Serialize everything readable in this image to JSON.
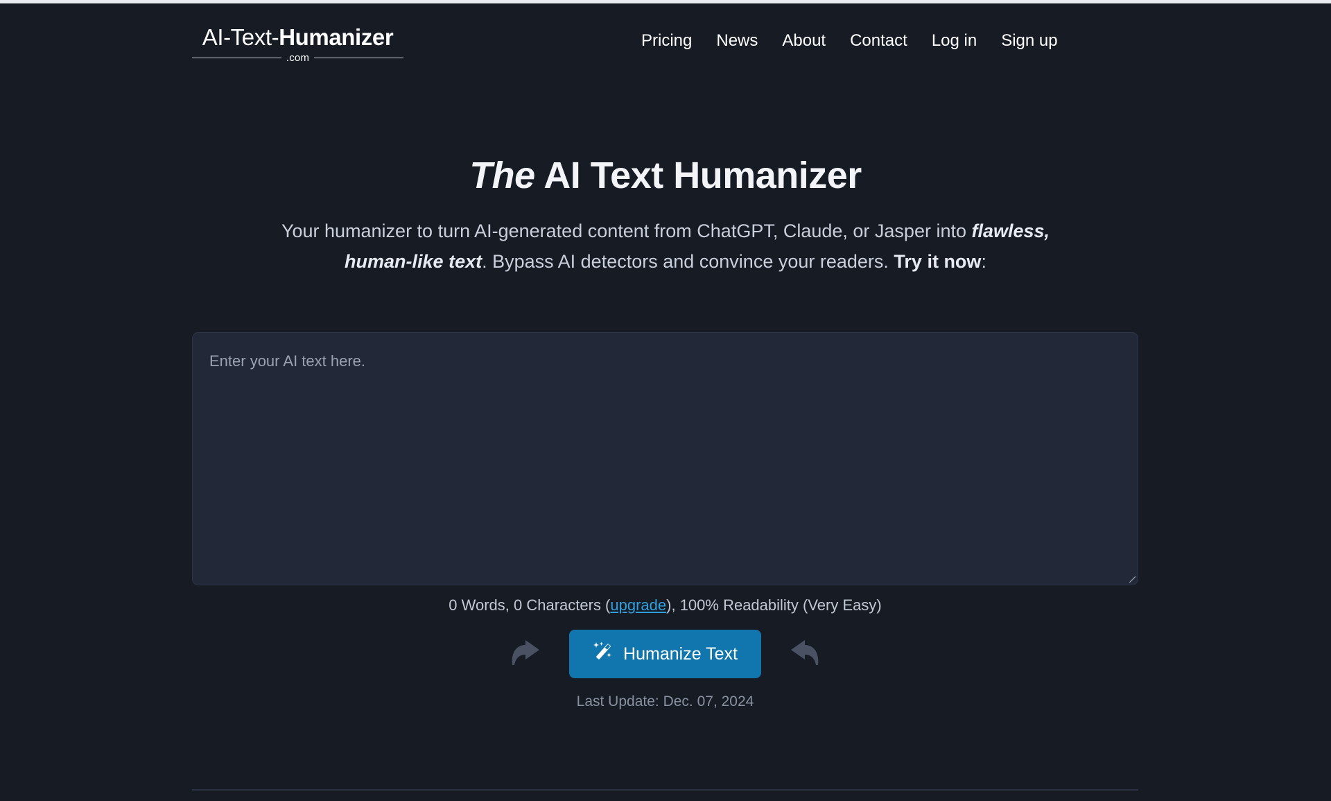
{
  "brand": {
    "logo_prefix": "AI-Text-",
    "logo_suffix": "Humanizer",
    "logo_domain": ".com"
  },
  "nav": {
    "items": [
      {
        "label": "Pricing"
      },
      {
        "label": "News"
      },
      {
        "label": "About"
      },
      {
        "label": "Contact"
      },
      {
        "label": "Log in"
      },
      {
        "label": "Sign up"
      }
    ]
  },
  "hero": {
    "title_italic": "The",
    "title_rest": " AI Text Humanizer",
    "sub_part1": "Your humanizer to turn AI-generated content from ChatGPT, Claude, or Jasper into ",
    "sub_emphasis1": "flawless, human-like text",
    "sub_part2": ". Bypass AI detectors and convince your readers. ",
    "sub_emphasis2": "Try it now",
    "sub_part3": ":"
  },
  "editor": {
    "placeholder": "Enter your AI text here.",
    "value": "",
    "stats_prefix": "0 Words, 0 Characters (",
    "stats_link": "upgrade",
    "stats_suffix": "), 100% Readability (Very Easy)",
    "words": 0,
    "characters": 0,
    "readability_percent": "100%",
    "readability_label": "Very Easy"
  },
  "actions": {
    "undo_icon": "curved-arrow-right-icon",
    "redo_icon": "curved-arrow-left-icon",
    "humanize_label": "Humanize Text",
    "humanize_icon": "magic-wand-icon",
    "humanize_color": "#1176ad"
  },
  "footer": {
    "last_update": "Last Update: Dec. 07, 2024"
  }
}
